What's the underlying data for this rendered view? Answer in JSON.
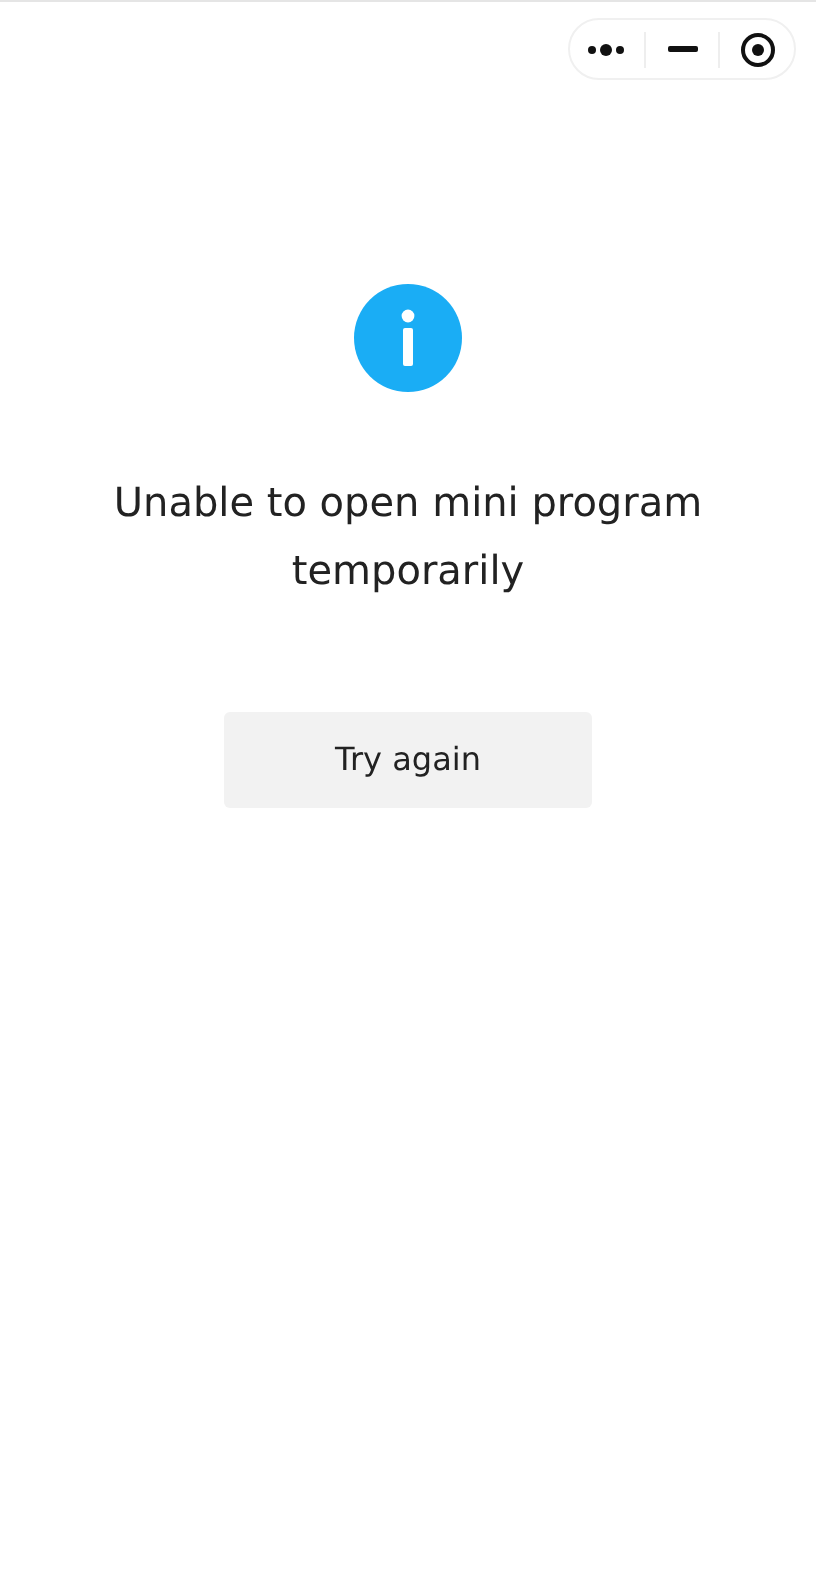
{
  "message": "Unable to open mini program temporarily",
  "retry_button": {
    "label": "Try again"
  }
}
